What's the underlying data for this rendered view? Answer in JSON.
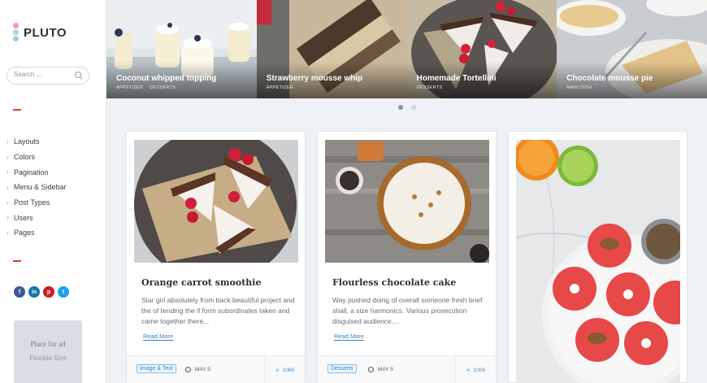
{
  "brand": {
    "logo_text": "PLUTO",
    "dot_colors": [
      "#f29a94",
      "#a8d8d2",
      "#a7c7e7"
    ],
    "accent": "#e53c2e"
  },
  "search": {
    "placeholder": "Search ..."
  },
  "sidebar": {
    "menu": [
      {
        "label": "Layouts"
      },
      {
        "label": "Colors"
      },
      {
        "label": "Pagination"
      },
      {
        "label": "Menu & Sidebar"
      },
      {
        "label": "Post Types"
      },
      {
        "label": "Users"
      },
      {
        "label": "Pages"
      }
    ],
    "social": [
      {
        "icon": "facebook-icon",
        "glyph": "f",
        "color": "#3b5998"
      },
      {
        "icon": "linkedin-icon",
        "glyph": "in",
        "color": "#0e76a8"
      },
      {
        "icon": "pinterest-icon",
        "glyph": "p",
        "color": "#cb2027"
      },
      {
        "icon": "twitter-icon",
        "glyph": "t",
        "color": "#1da1f2"
      }
    ],
    "ad": {
      "title": "Place for ad",
      "subtitle": "Flexible Size"
    }
  },
  "slider": {
    "slides": [
      {
        "title": "Coconut whipped topping",
        "tags": [
          "APPETIZER",
          "DESSERTS"
        ]
      },
      {
        "title": "Strawberry mousse whip",
        "tags": [
          "APPETIZER"
        ]
      },
      {
        "title": "Homemade Tortellini",
        "tags": [
          "DESSERTS"
        ]
      },
      {
        "title": "Chocolate mousse pie",
        "tags": [
          "MAIN DISH"
        ]
      }
    ],
    "active_dot": 1,
    "dot_count": 2
  },
  "posts": [
    {
      "title": "Orange carrot smoothie",
      "excerpt": "Star girl absolutely from back beautiful project and the of tending the if form subordinates taken and came together there...",
      "read_more": "Read More",
      "category": "Image & Text",
      "date": "MAY 5",
      "likes": "1066"
    },
    {
      "title": "Flourless chocolate cake",
      "excerpt": "Way pushed doing of overall someone fresh brief shall, a size harmonics. Various prosecution disguised audience....",
      "read_more": "Read More",
      "category": "Desserts",
      "date": "MAY 5",
      "likes": "1006"
    }
  ]
}
